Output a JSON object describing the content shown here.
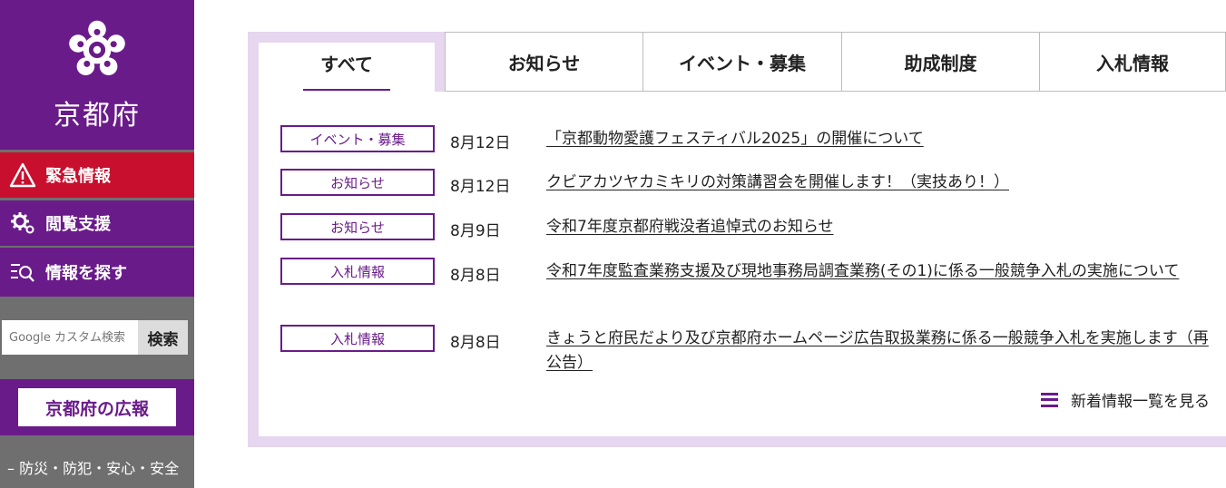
{
  "logo": {
    "text": "京都府"
  },
  "sidebar": {
    "emergency": "緊急情報",
    "support": "閲覧支援",
    "find": "情報を探す",
    "search_placeholder": "Google カスタム検索",
    "search_button": "検索",
    "pr_label": "京都府の広報",
    "category": "– 防災・防犯・安心・安全"
  },
  "tabs": [
    {
      "label": "すべて",
      "active": true
    },
    {
      "label": "お知らせ"
    },
    {
      "label": "イベント・募集"
    },
    {
      "label": "助成制度"
    },
    {
      "label": "入札情報"
    }
  ],
  "news": [
    {
      "badge": "イベント・募集",
      "date": "8月12日",
      "title": "「京都動物愛護フェスティバル2025」の開催について"
    },
    {
      "badge": "お知らせ",
      "date": "8月12日",
      "title": "クビアカツヤカミキリの対策講習会を開催します！（実技あり！）"
    },
    {
      "badge": "お知らせ",
      "date": "8月9日",
      "title": "令和7年度京都府戦没者追悼式のお知らせ"
    },
    {
      "badge": "入札情報",
      "date": "8月8日",
      "title": "令和7年度監査業務支援及び現地事務局調査業務(その1)に係る一般競争入札の実施について"
    },
    {
      "badge": "入札情報",
      "date": "8月8日",
      "title": "きょうと府民だより及び京都府ホームページ広告取扱業務に係る一般競争入札を実施します（再公告）"
    }
  ],
  "more_link": "新着情報一覧を見る",
  "colors": {
    "purple": "#6a1b8a",
    "red": "#c8102e",
    "panel_bg": "#e7d6ef"
  }
}
